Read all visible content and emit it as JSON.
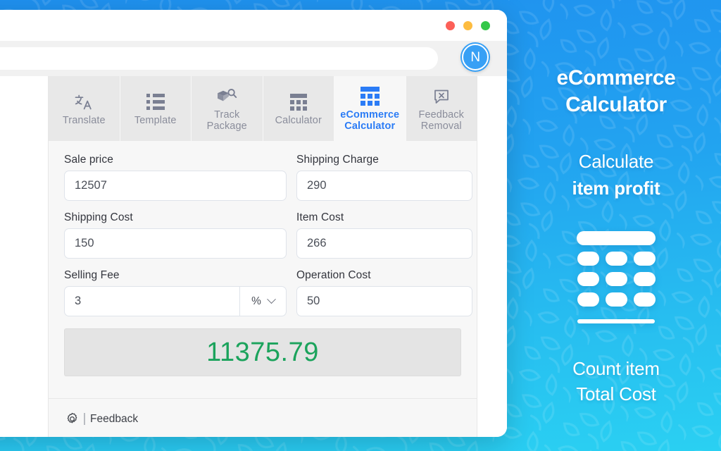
{
  "browser": {
    "traffic_lights": [
      "close",
      "minimize",
      "maximize"
    ],
    "address_bar_value": "",
    "address_bar_placeholder": "",
    "extension_badge_label": "N",
    "colors": {
      "close": "#fc6058",
      "minimize": "#fdbc40",
      "maximize": "#34c749",
      "badge": "#38a0f5"
    }
  },
  "popup": {
    "tabs": [
      {
        "label": "Translate",
        "icon": "translate-icon",
        "active": false
      },
      {
        "label": "Template",
        "icon": "template-list-icon",
        "active": false
      },
      {
        "label": "Track\nPackage",
        "icon": "package-search-icon",
        "active": false
      },
      {
        "label": "Calculator",
        "icon": "calculator-icon",
        "active": false
      },
      {
        "label": "eCommerce\nCalculator",
        "icon": "ecommerce-calculator-icon",
        "active": true
      },
      {
        "label": "Feedback\nRemoval",
        "icon": "comment-remove-icon",
        "active": false
      }
    ],
    "fields": [
      {
        "label": "Sale price",
        "value": "12507",
        "placeholder": "Sale price",
        "unit": null
      },
      {
        "label": "Shipping Charge",
        "value": "290",
        "placeholder": "Shipping Charge",
        "unit": null
      },
      {
        "label": "Shipping Cost",
        "value": "150",
        "placeholder": "Shipping Cost",
        "unit": null
      },
      {
        "label": "Item Cost",
        "value": "266",
        "placeholder": "Item Cost",
        "unit": null
      },
      {
        "label": "Selling Fee",
        "value": "3",
        "placeholder": "Selling Fee",
        "unit": "%"
      },
      {
        "label": "Operation Cost",
        "value": "50",
        "placeholder": "Operation Cost",
        "unit": null
      }
    ],
    "unit_options": [
      "%",
      "$"
    ],
    "result": {
      "value": "11375.79",
      "color": "#1ba35c"
    },
    "footer": {
      "gear_icon": "gear-icon",
      "separator": "|",
      "label": "Feedback"
    },
    "active_tab_color": "#2b7cf6"
  },
  "promo": {
    "title_line1": "eCommerce",
    "title_line2": "Calculator",
    "subtitle_line1": "Calculate",
    "subtitle_line2": "item profit",
    "footer_line1": "Count item",
    "footer_line2": "Total Cost",
    "graphic": "calculator-illustration",
    "background_from": "#1f90ef",
    "background_to": "#2ad0f2"
  }
}
